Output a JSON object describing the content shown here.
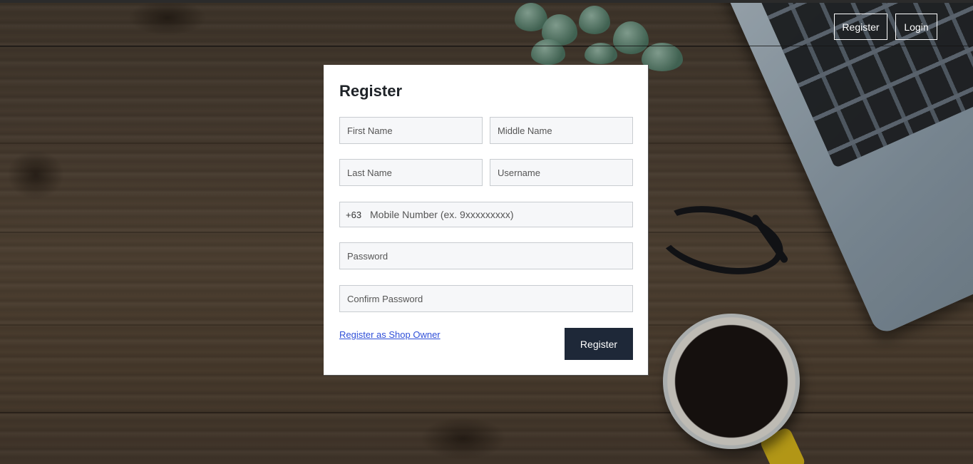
{
  "nav": {
    "register_label": "Register",
    "login_label": "Login"
  },
  "form": {
    "title": "Register",
    "first_name_placeholder": "First Name",
    "middle_name_placeholder": "Middle Name",
    "last_name_placeholder": "Last Name",
    "username_placeholder": "Username",
    "mobile_prefix": "+63",
    "mobile_placeholder": "Mobile Number (ex. 9xxxxxxxxx)",
    "password_placeholder": "Password",
    "confirm_password_placeholder": "Confirm Password",
    "shop_owner_link": "Register as Shop Owner",
    "submit_label": "Register"
  },
  "colors": {
    "submit_bg": "#1e2838",
    "link": "#2f4fd8",
    "field_bg": "#f6f7f9"
  }
}
